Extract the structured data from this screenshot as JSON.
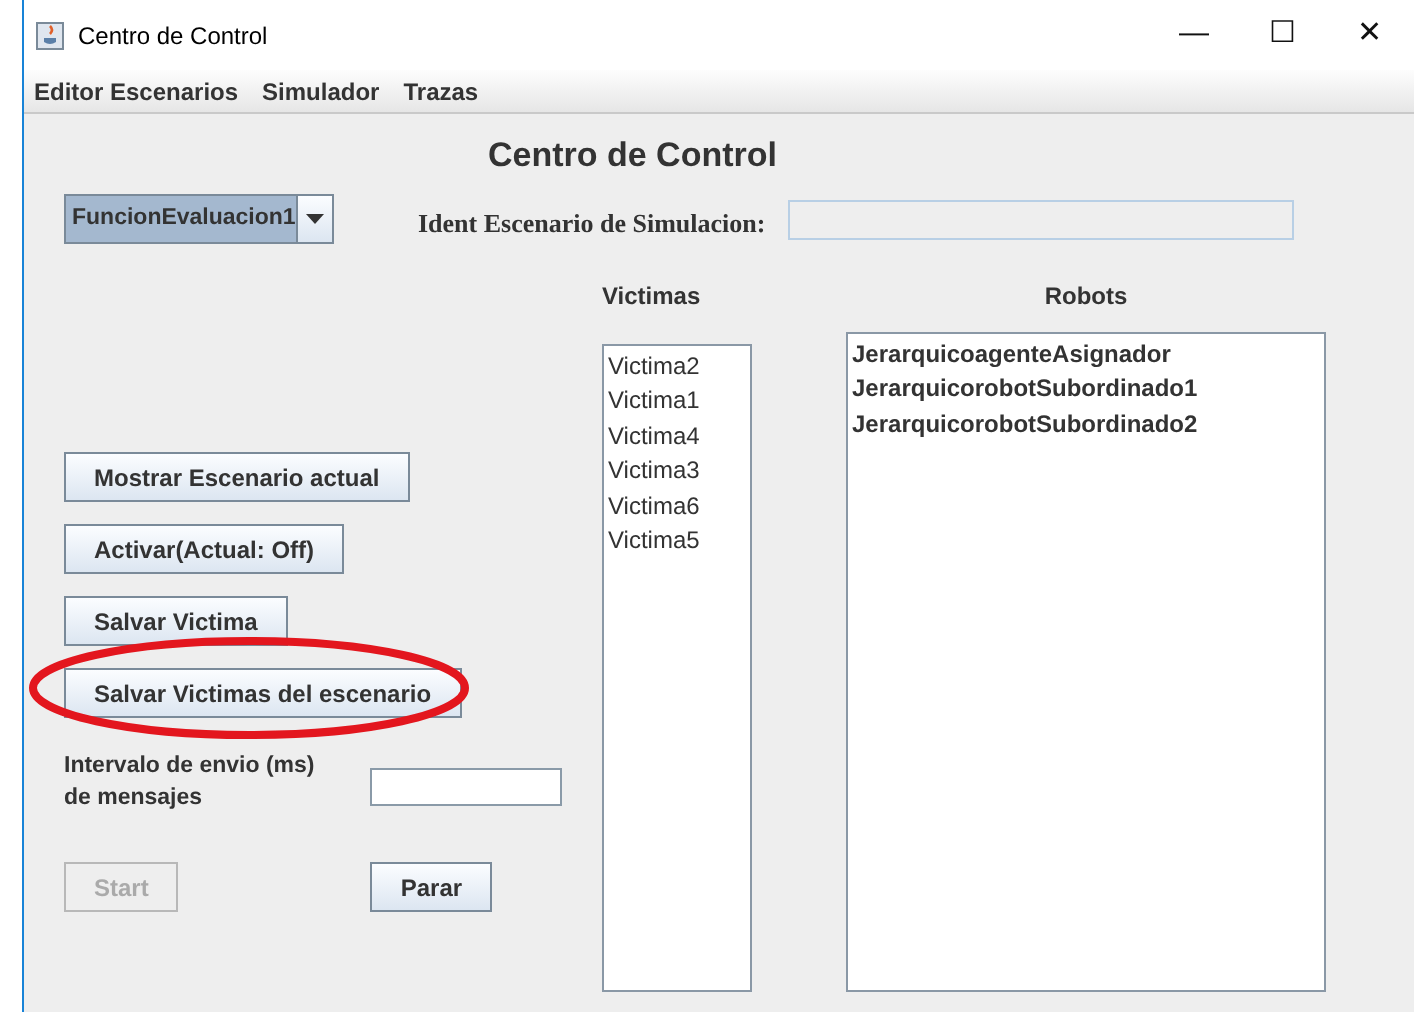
{
  "window": {
    "title": "Centro de Control",
    "controls": [
      "—",
      "☐",
      "✕"
    ]
  },
  "menu": [
    "Editor Escenarios",
    "Simulador",
    "Trazas"
  ],
  "heading": "Centro de Control",
  "evaluation_combo": {
    "value": "FuncionEvaluacion1"
  },
  "scenario_id": {
    "label": "Ident Escenario de Simulacion:"
  },
  "victims": {
    "label": "Victimas",
    "items": [
      "Victima2",
      "Victima1",
      "Victima4",
      "Victima3",
      "Victima6",
      "Victima5"
    ]
  },
  "robots": {
    "label": "Robots",
    "items": [
      "JerarquicoagenteAsignador",
      "JerarquicorobotSubordinado1",
      "JerarquicorobotSubordinado2"
    ]
  },
  "buttons": [
    {
      "label": "Mostrar Escenario actual",
      "circled": false
    },
    {
      "label": "Activar(Actual: Off)",
      "circled": false
    },
    {
      "label": "Salvar Victima",
      "circled": false
    },
    {
      "label": "Salvar Victimas del escenario",
      "circled": true
    }
  ],
  "interval": {
    "label_lines": [
      "Intervalo de envio (ms)",
      "de mensajes"
    ]
  },
  "actions": [
    {
      "label": "Start",
      "disabled": true
    },
    {
      "label": "Parar",
      "disabled": false
    }
  ]
}
